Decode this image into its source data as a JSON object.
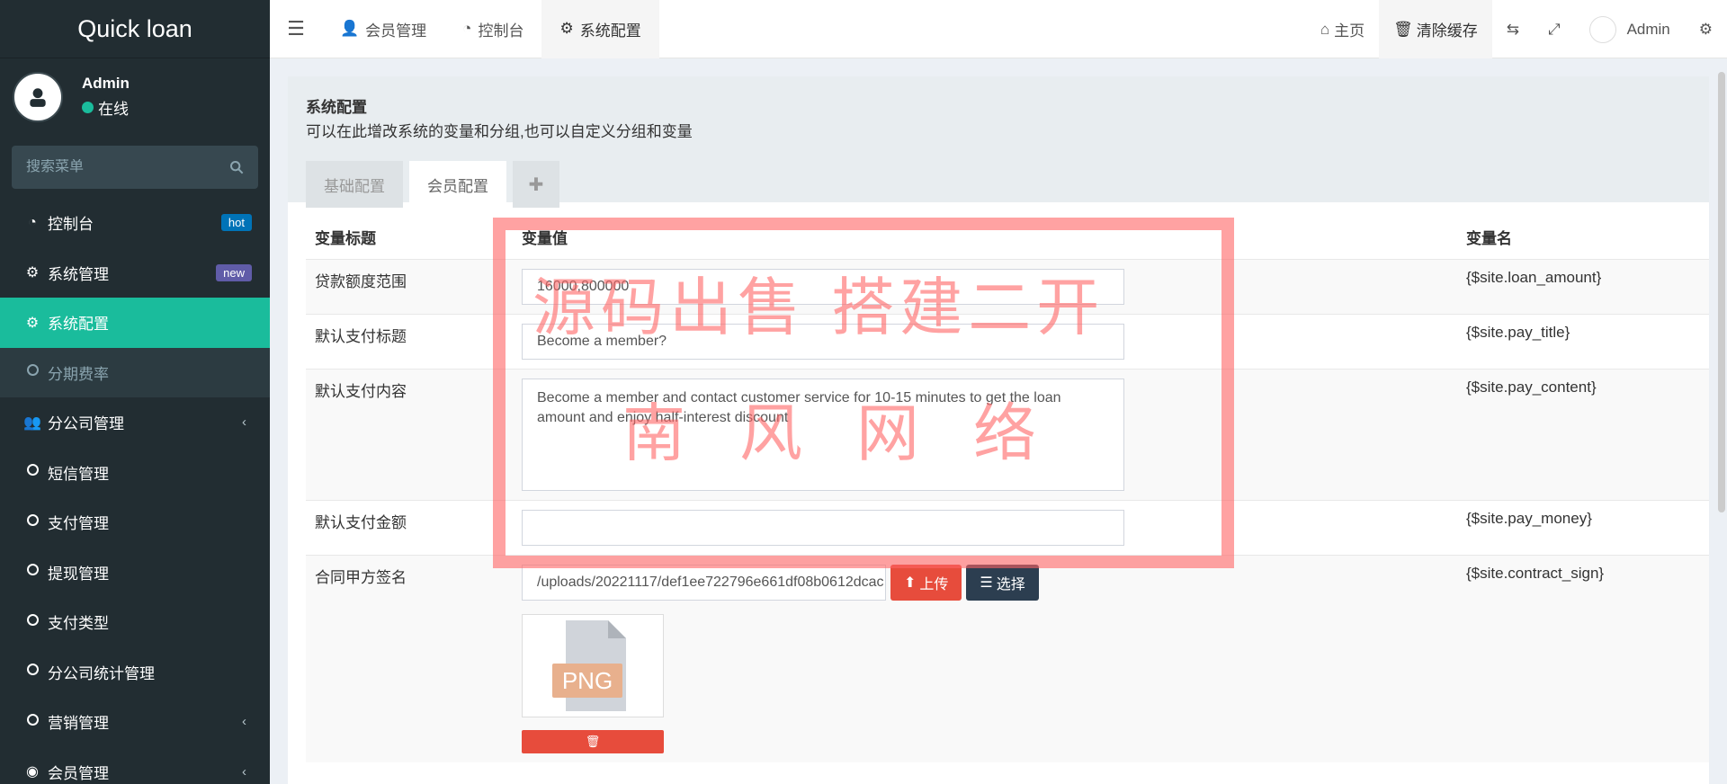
{
  "brand": "Quick loan",
  "user": {
    "name": "Admin",
    "status": "在线"
  },
  "sidebar": {
    "search_placeholder": "搜索菜单",
    "items": [
      {
        "label": "控制台",
        "badge": "hot"
      },
      {
        "label": "系统管理",
        "badge": "new"
      },
      {
        "label": "系统配置"
      },
      {
        "label": "分期费率"
      },
      {
        "label": "分公司管理"
      },
      {
        "label": "短信管理"
      },
      {
        "label": "支付管理"
      },
      {
        "label": "提现管理"
      },
      {
        "label": "支付类型"
      },
      {
        "label": "分公司统计管理"
      },
      {
        "label": "营销管理"
      },
      {
        "label": "会员管理"
      }
    ]
  },
  "navbar": {
    "tabs": [
      {
        "label": "会员管理"
      },
      {
        "label": "控制台"
      },
      {
        "label": "系统配置"
      }
    ],
    "home": "主页",
    "clear_cache": "清除缓存",
    "admin": "Admin"
  },
  "panel": {
    "title": "系统配置",
    "desc": "可以在此增改系统的变量和分组,也可以自定义分组和变量",
    "tabs": [
      {
        "label": "基础配置"
      },
      {
        "label": "会员配置"
      }
    ]
  },
  "table": {
    "headers": {
      "title": "变量标题",
      "value": "变量值",
      "name": "变量名"
    },
    "rows": [
      {
        "title": "贷款额度范围",
        "value": "16000,800000",
        "name": "{$site.loan_amount}"
      },
      {
        "title": "默认支付标题",
        "value": "Become a member?",
        "name": "{$site.pay_title}"
      },
      {
        "title": "默认支付内容",
        "value": "Become a member and contact customer service for 10-15 minutes to get the loan amount and enjoy half-interest discount",
        "name": "{$site.pay_content}"
      },
      {
        "title": "默认支付金额",
        "value": "",
        "name": "{$site.pay_money}"
      },
      {
        "title": "合同甲方签名",
        "value": "/uploads/20221117/def1ee722796e661df08b0612dcac",
        "name": "{$site.contract_sign}",
        "upload": "上传",
        "select": "选择",
        "thumb_label": "PNG"
      }
    ]
  },
  "watermark": {
    "line1": "源码出售 搭建二开",
    "line2": "南风网络"
  },
  "colors": {
    "sidebar": "#222d32",
    "accent": "#1abc9c",
    "hot": "#0073b7",
    "new": "#605ca8",
    "danger": "#e74c3c",
    "dark_btn": "#2c3e50"
  }
}
